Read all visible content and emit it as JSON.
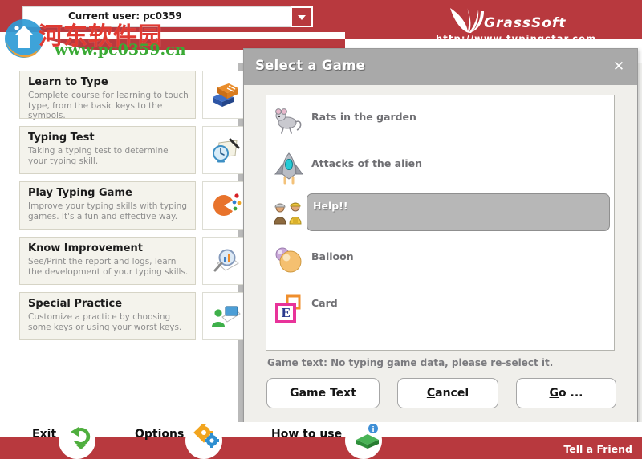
{
  "header": {
    "user_combo": {
      "label": "Current user: pc0359",
      "dropdown_icon": "chevron-down-icon"
    },
    "brand": {
      "name": "GrassSoft",
      "url": "http://www.typingstar.com",
      "logo_icon": "grass-leaf-icon"
    },
    "watermark": {
      "site_cn": "河东软件园",
      "site_url": "www.pc0359.cn",
      "logo_icon": "pc0359-logo-icon"
    },
    "accent_color": "#b8393e"
  },
  "menu": {
    "items": [
      {
        "title": "Learn to Type",
        "desc": "Complete course for learning to touch type, from the basic keys to the symbols.",
        "icon": "books-icon"
      },
      {
        "title": "Typing Test",
        "desc": "Taking a typing test to determine your typing skill.",
        "icon": "clock-pen-icon"
      },
      {
        "title": "Play Typing Game",
        "desc": "Improve your typing skills with typing games. It's a fun and effective way.",
        "icon": "pacman-dots-icon"
      },
      {
        "title": "Know Improvement",
        "desc": "See/Print the report and logs, learn the development of your typing skills.",
        "icon": "magnifier-report-icon"
      },
      {
        "title": "Special Practice",
        "desc": "Customize a practice by choosing some keys or using your worst keys.",
        "icon": "user-computer-icon"
      }
    ]
  },
  "dialog": {
    "title": "Select a Game",
    "close_icon": "close-icon",
    "games": [
      {
        "label": "Rats in the garden",
        "icon": "rat-icon",
        "selected": false
      },
      {
        "label": "Attacks of the alien",
        "icon": "spaceship-icon",
        "selected": false
      },
      {
        "label": "Help!!",
        "icon": "firemen-icon",
        "selected": true
      },
      {
        "label": "Balloon",
        "icon": "balloon-icon",
        "selected": false
      },
      {
        "label": "Card",
        "icon": "card-e-icon",
        "selected": false
      }
    ],
    "status": "Game text: No typing game data, please re-select it.",
    "buttons": {
      "game_text": "Game Text",
      "cancel_mnemonic": "C",
      "cancel_rest": "ancel",
      "go_mnemonic": "G",
      "go_rest": "o ..."
    },
    "titlebar_color": "#a9a9a9",
    "selection_color": "#b7b7b7"
  },
  "bottom": {
    "items": [
      {
        "label": "Exit",
        "icon": "green-arrow-icon"
      },
      {
        "label": "Options",
        "icon": "gears-icon"
      },
      {
        "label": "How to use",
        "icon": "green-book-icon"
      }
    ],
    "tell_a_friend": "Tell a Friend"
  }
}
